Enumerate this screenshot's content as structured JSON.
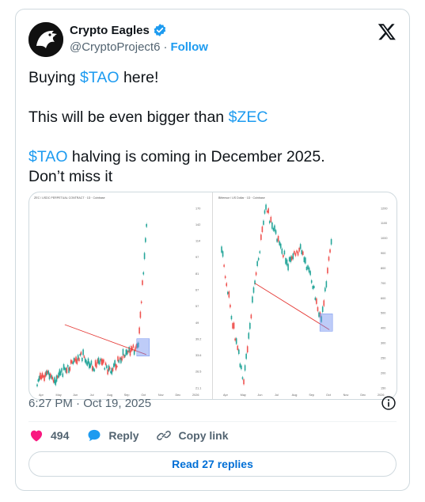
{
  "author": {
    "display_name": "Crypto Eagles",
    "handle": "@CryptoProject6",
    "separator": "·",
    "follow_label": "Follow"
  },
  "tweet": {
    "lines": [
      {
        "pre": "Buying ",
        "tag": "$TAO",
        "post": " here!"
      },
      {
        "pre": "This will be even bigger than ",
        "tag": "$ZEC",
        "post": ""
      },
      {
        "pre": "",
        "tag": "$TAO",
        "post": " halving is coming in December 2025."
      },
      {
        "pre": "Don’t miss it",
        "tag": "",
        "post": ""
      }
    ]
  },
  "timestamp": "6:27 PM · Oct 19, 2025",
  "actions": {
    "like_count": "494",
    "reply_label": "Reply",
    "copy_link_label": "Copy link"
  },
  "read_replies_label": "Read 27 replies",
  "colors": {
    "accent": "#1d9bf0",
    "like": "#f91880",
    "candle_up": "#26a69a",
    "candle_down": "#ef5350",
    "trendline": "#e53935",
    "highlight_box": "#6f8fef"
  },
  "icons": {
    "avatar": "eagle-logo",
    "verified": "verified-badge-icon",
    "brand": "x-logo-icon",
    "info": "info-icon",
    "like": "heart-icon",
    "reply": "speech-bubble-icon",
    "copy_link": "link-icon"
  },
  "chart_data": [
    {
      "type": "line",
      "title": "ZEC / USDC PERPETUAL CONTRACT · 1D · Coinbase",
      "xlabel": "",
      "ylabel": "",
      "x": [
        "Apr",
        "May",
        "Jun",
        "Jul",
        "Aug",
        "Sep",
        "Oct",
        "Nov",
        "Dec",
        "2026"
      ],
      "y_ticks": [
        21.1,
        26.5,
        33.6,
        39.2,
        49.0,
        57.0,
        67.0,
        81.0,
        97.0,
        114.0,
        142.0,
        170.0
      ],
      "series": [
        {
          "values": [
            28,
            34,
            29,
            38,
            44,
            52,
            40,
            46,
            36,
            48,
            55,
            58,
            185
          ]
        }
      ],
      "annotations": [
        "descending trendline",
        "breakout box"
      ]
    },
    {
      "type": "line",
      "title": "Bittensor / US Dollar · 1D · Coinbase",
      "xlabel": "",
      "ylabel": "",
      "x": [
        "Apr",
        "May",
        "Jun",
        "Jul",
        "Aug",
        "Sep",
        "Oct",
        "Nov",
        "Dec",
        "2026"
      ],
      "y_ticks": [
        150,
        200,
        250,
        300,
        400,
        500,
        600,
        700,
        800,
        900,
        1000,
        1100,
        1200
      ],
      "series": [
        {
          "values": [
            420,
            330,
            260,
            380,
            470,
            430,
            400,
            420,
            390,
            330,
            440
          ]
        }
      ],
      "annotations": [
        "descending trendline",
        "breakout box"
      ]
    }
  ]
}
